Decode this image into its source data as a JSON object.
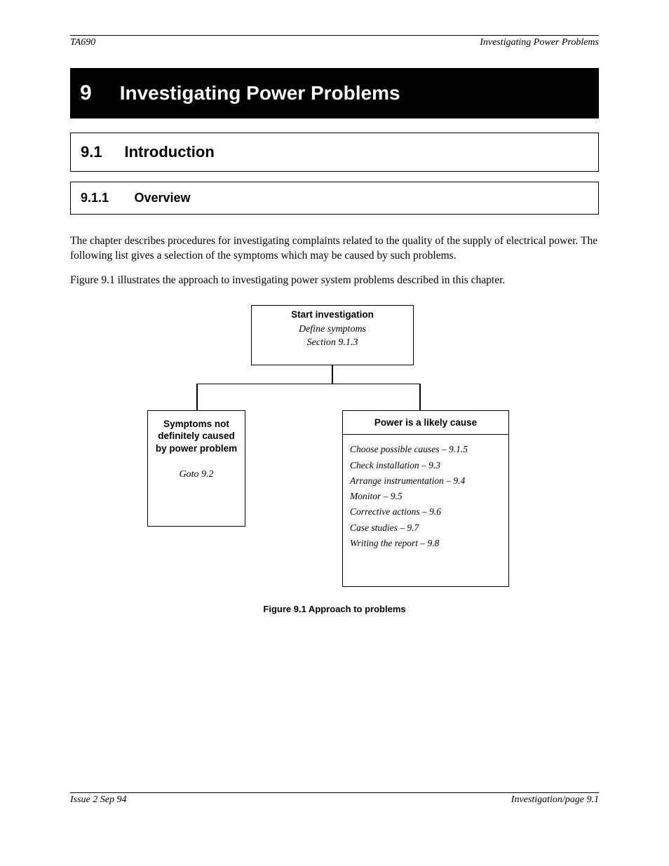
{
  "header": {
    "left": "TA690",
    "right": "Investigating Power Problems"
  },
  "title": {
    "chapter_num": "9",
    "chapter_title": "Investigating Power Problems"
  },
  "section": {
    "num": "9.1",
    "label": "Introduction"
  },
  "subsection": {
    "num": "9.1.1",
    "label": "Overview"
  },
  "paragraphs": [
    "The chapter describes procedures for investigating complaints related to the quality of the supply of electrical power. The following list gives a selection of the symptoms which may be caused by such problems.",
    "Figure 9.1 illustrates the approach to investigating power system problems described in this chapter."
  ],
  "diagram": {
    "root": {
      "heading": "Start investigation",
      "body": "Define symptoms\nSection 9.1.3"
    },
    "left": {
      "heading": "Symptoms not\ndefinitely caused\nby power problem",
      "body": "Goto 9.2"
    },
    "right": {
      "heading": "Power is a likely cause",
      "items": [
        "Choose possible causes – 9.1.5",
        "Check installation – 9.3",
        "Arrange instrumentation – 9.4",
        "Monitor – 9.5",
        "Corrective actions – 9.6",
        "Case studies – 9.7",
        "Writing the report – 9.8"
      ]
    },
    "caption": "Figure 9.1 Approach to problems"
  },
  "footer": {
    "left": "Issue 2  Sep 94",
    "right": "Investigation/page 9.1"
  }
}
